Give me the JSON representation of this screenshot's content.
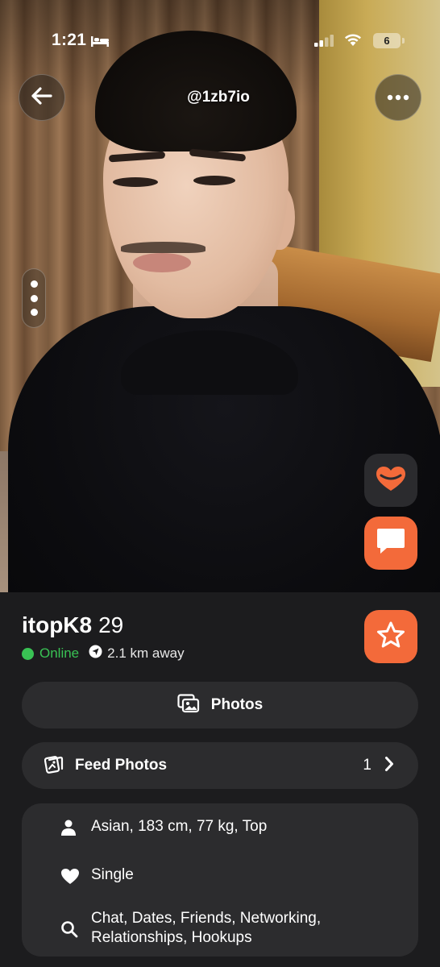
{
  "status_bar": {
    "time": "1:21",
    "battery": "6"
  },
  "header": {
    "handle": "@1zb7io"
  },
  "profile": {
    "name": "itopK8",
    "age": "29",
    "online_label": "Online",
    "distance": "2.1 km away"
  },
  "actions": {
    "photos_label": "Photos",
    "feed_photos_label": "Feed Photos",
    "feed_photos_count": "1"
  },
  "details": {
    "stats": "Asian, 183 cm, 77 kg, Top",
    "relationship": "Single",
    "looking_for": "Chat, Dates, Friends, Networking, Relationships, Hookups"
  },
  "colors": {
    "accent": "#f36a3a",
    "online": "#39c254",
    "background": "#1c1c1e",
    "card": "#2c2c2e"
  },
  "icons": [
    "back-arrow-icon",
    "more-icon",
    "tap-icon",
    "chat-icon",
    "star-icon",
    "photos-icon",
    "feed-photos-icon",
    "chevron-right-icon",
    "person-icon",
    "heart-icon",
    "search-icon",
    "location-arrow-icon"
  ]
}
